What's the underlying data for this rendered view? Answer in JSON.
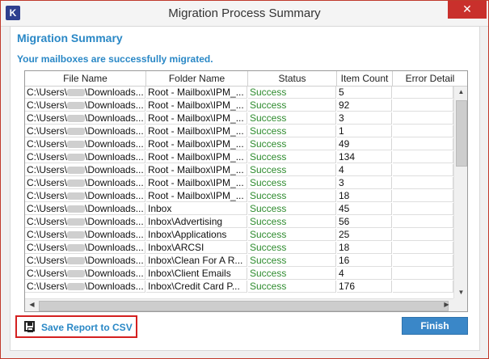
{
  "window": {
    "title": "Migration Process Summary",
    "logo_letter": "K",
    "close_glyph": "✕"
  },
  "summary": {
    "heading": "Migration Summary",
    "message": "Your mailboxes are successfully migrated."
  },
  "table": {
    "columns": [
      "File Name",
      "Folder Name",
      "Status",
      "Item Count",
      "Error Detail"
    ],
    "rows": [
      {
        "file_prefix": "C:\\Users\\",
        "file_suffix": "\\Downloads...",
        "folder": "Root - Mailbox\\IPM_...",
        "status": "Success",
        "count": "5",
        "error": ""
      },
      {
        "file_prefix": "C:\\Users\\",
        "file_suffix": "\\Downloads...",
        "folder": "Root - Mailbox\\IPM_...",
        "status": "Success",
        "count": "92",
        "error": ""
      },
      {
        "file_prefix": "C:\\Users\\",
        "file_suffix": "\\Downloads...",
        "folder": "Root - Mailbox\\IPM_...",
        "status": "Success",
        "count": "3",
        "error": ""
      },
      {
        "file_prefix": "C:\\Users\\",
        "file_suffix": "\\Downloads...",
        "folder": "Root - Mailbox\\IPM_...",
        "status": "Success",
        "count": "1",
        "error": ""
      },
      {
        "file_prefix": "C:\\Users\\",
        "file_suffix": "\\Downloads...",
        "folder": "Root - Mailbox\\IPM_...",
        "status": "Success",
        "count": "49",
        "error": ""
      },
      {
        "file_prefix": "C:\\Users\\",
        "file_suffix": "\\Downloads...",
        "folder": "Root - Mailbox\\IPM_...",
        "status": "Success",
        "count": "134",
        "error": ""
      },
      {
        "file_prefix": "C:\\Users\\",
        "file_suffix": "\\Downloads...",
        "folder": "Root - Mailbox\\IPM_...",
        "status": "Success",
        "count": "4",
        "error": ""
      },
      {
        "file_prefix": "C:\\Users\\",
        "file_suffix": "\\Downloads...",
        "folder": "Root - Mailbox\\IPM_...",
        "status": "Success",
        "count": "3",
        "error": ""
      },
      {
        "file_prefix": "C:\\Users\\",
        "file_suffix": "\\Downloads...",
        "folder": "Root - Mailbox\\IPM_...",
        "status": "Success",
        "count": "18",
        "error": ""
      },
      {
        "file_prefix": "C:\\Users\\",
        "file_suffix": "\\Downloads...",
        "folder": "Inbox",
        "status": "Success",
        "count": "45",
        "error": ""
      },
      {
        "file_prefix": "C:\\Users\\",
        "file_suffix": "\\Downloads...",
        "folder": "Inbox\\Advertising",
        "status": "Success",
        "count": "56",
        "error": ""
      },
      {
        "file_prefix": "C:\\Users\\",
        "file_suffix": "\\Downloads...",
        "folder": "Inbox\\Applications",
        "status": "Success",
        "count": "25",
        "error": ""
      },
      {
        "file_prefix": "C:\\Users\\",
        "file_suffix": "\\Downloads...",
        "folder": "Inbox\\ARCSI",
        "status": "Success",
        "count": "18",
        "error": ""
      },
      {
        "file_prefix": "C:\\Users\\",
        "file_suffix": "\\Downloads...",
        "folder": "Inbox\\Clean For A R...",
        "status": "Success",
        "count": "16",
        "error": ""
      },
      {
        "file_prefix": "C:\\Users\\",
        "file_suffix": "\\Downloads...",
        "folder": "Inbox\\Client Emails",
        "status": "Success",
        "count": "4",
        "error": ""
      },
      {
        "file_prefix": "C:\\Users\\",
        "file_suffix": "\\Downloads...",
        "folder": "Inbox\\Credit Card P...",
        "status": "Success",
        "count": "176",
        "error": ""
      }
    ]
  },
  "buttons": {
    "save_label": "Save Report to CSV",
    "finish_label": "Finish"
  },
  "colors": {
    "accent": "#2a88c6",
    "success": "#2e8b2e",
    "highlight_border": "#d42020",
    "close_bg": "#c9302c"
  },
  "icons": {
    "logo": "kernel-logo-icon",
    "save": "floppy-disk-icon",
    "close": "close-icon"
  }
}
